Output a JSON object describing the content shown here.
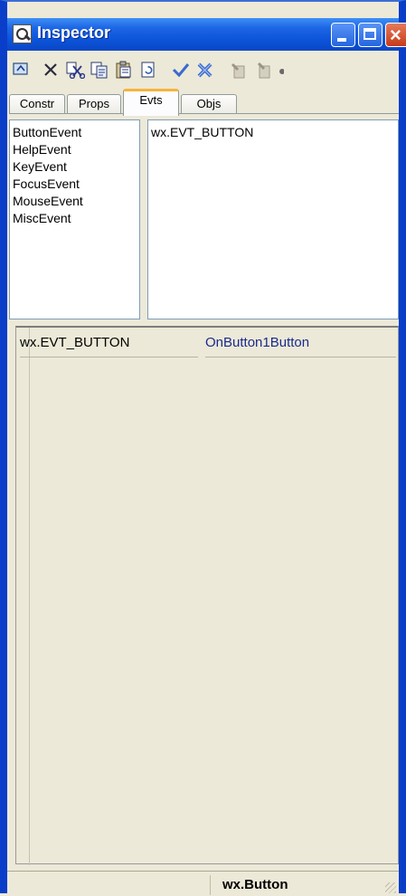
{
  "window": {
    "title": "Inspector"
  },
  "titlebar_buttons": [
    "minimize",
    "maximize",
    "close"
  ],
  "toolbar": {
    "icons": [
      "up-icon",
      "delete-icon",
      "cut-icon",
      "copy-icon",
      "paste-icon",
      "refresh-icon",
      "apply-icon",
      "cancel-icon",
      "add-icon",
      "remove-icon"
    ]
  },
  "tabs": [
    {
      "label": "Constr"
    },
    {
      "label": "Props"
    },
    {
      "label": "Evts",
      "active": true
    },
    {
      "label": "Objs"
    }
  ],
  "event_categories": [
    "ButtonEvent",
    "HelpEvent",
    "KeyEvent",
    "FocusEvent",
    "MouseEvent",
    "MiscEvent"
  ],
  "event_types": [
    "wx.EVT_BUTTON"
  ],
  "event_handlers": [
    {
      "event": "wx.EVT_BUTTON",
      "handler": "OnButton1Button"
    }
  ],
  "status": {
    "class_name": "wx.Button"
  },
  "colors": {
    "titlebar": "#0a52d8",
    "handler_text": "#1a2a8c",
    "active_tab_accent": "#f7b33c",
    "selection": "#f0ead2"
  }
}
